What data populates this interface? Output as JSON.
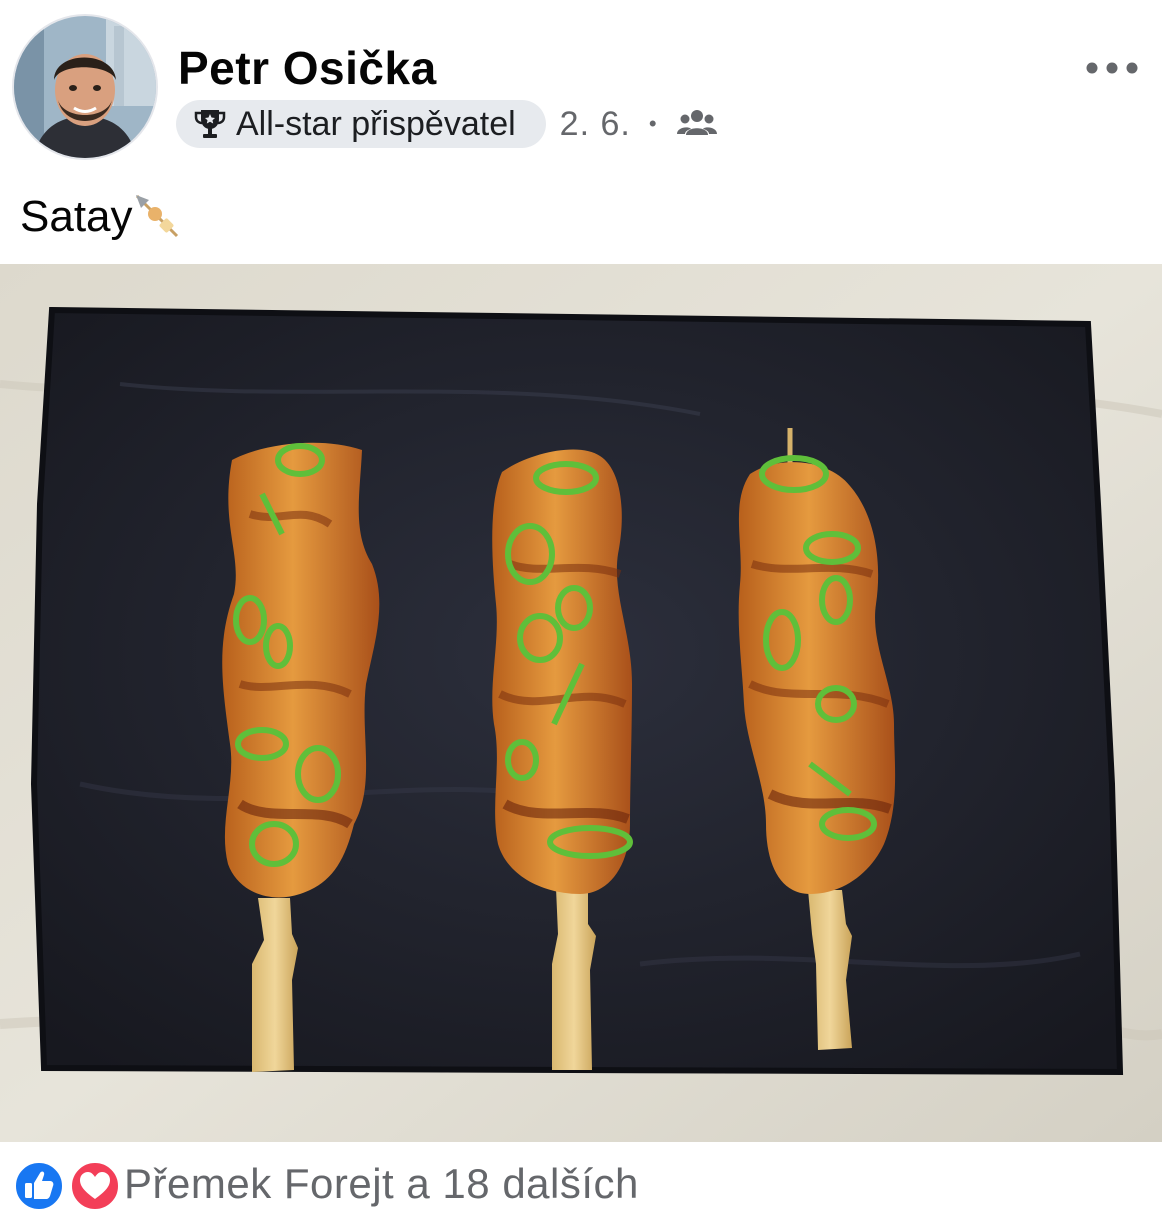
{
  "post": {
    "author": {
      "name": "Petr Osička"
    },
    "badge": {
      "label": "All-star přispěvatel",
      "icon": "trophy-icon"
    },
    "date": "2. 6.",
    "separator": "•",
    "audience_icon": "group-icon",
    "more_icon": "more-options-icon",
    "text": "Satay",
    "text_emoji": "oden-skewer-emoji"
  },
  "photo": {
    "subject": "three satay skewers on a black slate board",
    "icon": "post-photo"
  },
  "reactions": {
    "types": [
      "like",
      "love"
    ],
    "summary": "Přemek Forejt a 18 dalších",
    "colors": {
      "like": "#1877f2",
      "love": "#f33e58"
    }
  }
}
